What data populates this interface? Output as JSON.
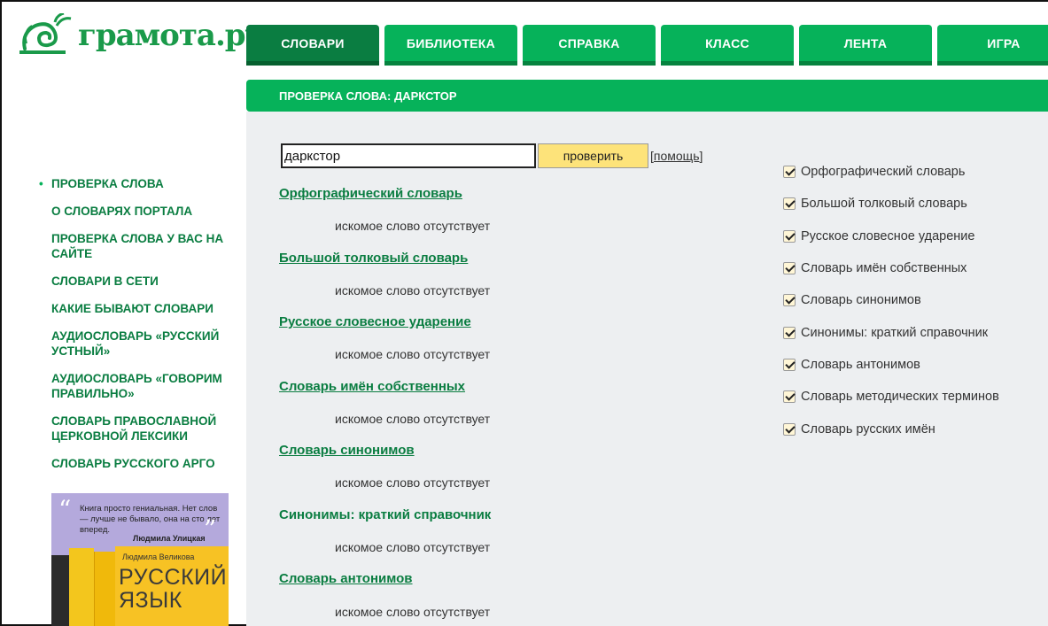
{
  "logo": {
    "text": "грамота.ру",
    "icon": "snail-logo-icon",
    "color": "#1a9a4a"
  },
  "nav": {
    "tabs": [
      {
        "label": "СЛОВАРИ",
        "active": true
      },
      {
        "label": "БИБЛИОТЕКА",
        "active": false
      },
      {
        "label": "СПРАВКА",
        "active": false
      },
      {
        "label": "КЛАСС",
        "active": false
      },
      {
        "label": "ЛЕНТА",
        "active": false
      },
      {
        "label": "ИГРА",
        "active": false
      }
    ]
  },
  "page_title": "ПРОВЕРКА СЛОВА: ДАРКСТОР",
  "sidebar": {
    "items": [
      {
        "label": "ПРОВЕРКА СЛОВА",
        "active": true
      },
      {
        "label": "О СЛОВАРЯХ ПОРТАЛА"
      },
      {
        "label": "ПРОВЕРКА СЛОВА У ВАС НА САЙТЕ"
      },
      {
        "label": "СЛОВАРИ В СЕТИ"
      },
      {
        "label": "КАКИЕ БЫВАЮТ СЛОВАРИ"
      },
      {
        "label": "АУДИОСЛОВАРЬ «РУССКИЙ УСТНЫЙ»"
      },
      {
        "label": "АУДИОСЛОВАРЬ «ГОВОРИМ ПРАВИЛЬНО»"
      },
      {
        "label": "СЛОВАРЬ ПРАВОСЛАВНОЙ ЦЕРКОВНОЙ ЛЕКСИКИ"
      },
      {
        "label": "СЛОВАРЬ РУССКОГО АРГО"
      }
    ]
  },
  "banner": {
    "quote": "Книга просто гениальная. Нет слов — лучше не бывало, она на сто лет вперед.",
    "quote_author": "Людмила Улицкая",
    "book_author": "Людмила Великова",
    "book_title": "РУССКИЙ ЯЗЫК"
  },
  "search": {
    "value": "даркстор",
    "button_label": "проверить",
    "help_label": "помощь"
  },
  "results": [
    {
      "title": "Орфографический словарь",
      "text": "искомое слово отсутствует"
    },
    {
      "title": "Большой толковый словарь",
      "text": "искомое слово отсутствует"
    },
    {
      "title": "Русское словесное ударение",
      "text": "искомое слово отсутствует"
    },
    {
      "title": "Словарь имён собственных",
      "text": "искомое слово отсутствует"
    },
    {
      "title": "Словарь синонимов",
      "text": "искомое слово отсутствует"
    },
    {
      "title": "Синонимы: краткий справочник",
      "text": "искомое слово отсутствует"
    },
    {
      "title": "Словарь антонимов",
      "text": "искомое слово отсутствует"
    }
  ],
  "checklist": [
    {
      "label": "Орфографический словарь",
      "checked": true
    },
    {
      "label": "Большой толковый словарь",
      "checked": true
    },
    {
      "label": "Русское словесное ударение",
      "checked": true
    },
    {
      "label": "Словарь имён собственных",
      "checked": true
    },
    {
      "label": "Словарь синонимов",
      "checked": true
    },
    {
      "label": "Синонимы: краткий справочник",
      "checked": true
    },
    {
      "label": "Словарь антонимов",
      "checked": true
    },
    {
      "label": "Словарь методических терминов",
      "checked": true
    },
    {
      "label": "Словарь русских имён",
      "checked": true
    }
  ],
  "colors": {
    "accent": "#06b25a",
    "accent_dark": "#0a7d41",
    "button": "#fde37a",
    "content_bg": "#edeff1"
  }
}
